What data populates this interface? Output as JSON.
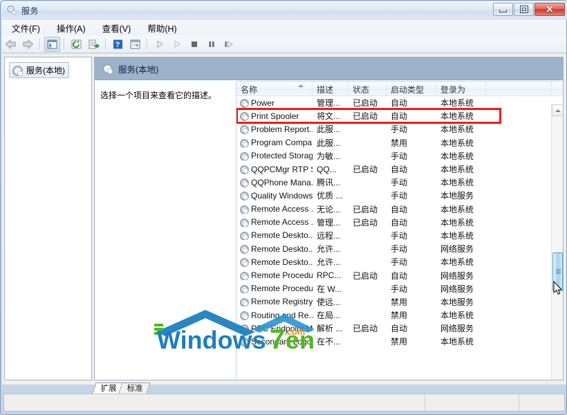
{
  "window": {
    "title": "服务",
    "title_icon": "services-gear-icon",
    "buttons": {
      "minimize": "最小化",
      "restore": "还原",
      "close": "关闭",
      "close_glyph": "✕"
    }
  },
  "menubar": {
    "items": [
      {
        "label": "文件(F)",
        "name": "menu-file"
      },
      {
        "label": "操作(A)",
        "name": "menu-action"
      },
      {
        "label": "查看(V)",
        "name": "menu-view"
      },
      {
        "label": "帮助(H)",
        "name": "menu-help"
      }
    ]
  },
  "toolbar": {
    "items": [
      {
        "name": "back-arrow-icon",
        "label": "后退",
        "enabled": true
      },
      {
        "name": "forward-arrow-icon",
        "label": "前进",
        "enabled": true
      },
      {
        "name": "separator-1",
        "label": "",
        "enabled": false
      },
      {
        "name": "show-hide-tree-icon",
        "label": "显示/隐藏控制台树",
        "enabled": true
      },
      {
        "name": "separator-2",
        "label": "",
        "enabled": false
      },
      {
        "name": "refresh-icon",
        "label": "刷新",
        "enabled": true
      },
      {
        "name": "export-list-icon",
        "label": "导出列表",
        "enabled": true
      },
      {
        "name": "separator-3",
        "label": "",
        "enabled": false
      },
      {
        "name": "help-icon",
        "label": "帮助",
        "enabled": true
      },
      {
        "name": "properties-icon",
        "label": "属性",
        "enabled": true
      },
      {
        "name": "separator-4",
        "label": "",
        "enabled": false
      },
      {
        "name": "start-service-icon",
        "label": "启动服务",
        "enabled": false
      },
      {
        "name": "start-all-icon",
        "label": "启动",
        "enabled": false
      },
      {
        "name": "stop-service-icon",
        "label": "停止服务",
        "enabled": false
      },
      {
        "name": "pause-service-icon",
        "label": "暂停服务",
        "enabled": false
      },
      {
        "name": "restart-service-icon",
        "label": "重启动服务",
        "enabled": false
      }
    ]
  },
  "tree": {
    "root": {
      "label": "服务(本地)",
      "icon": "services-gear-icon",
      "selected": true
    }
  },
  "pane": {
    "header": "服务(本地)",
    "header_icon": "services-gear-icon",
    "description": "选择一个项目来查看它的描述。"
  },
  "list": {
    "columns": [
      {
        "label": "名称",
        "width": 110,
        "sorted": "asc"
      },
      {
        "label": "描述",
        "width": 52,
        "sorted": ""
      },
      {
        "label": "状态",
        "width": 55,
        "sorted": ""
      },
      {
        "label": "启动类型",
        "width": 72,
        "sorted": ""
      },
      {
        "label": "登录为",
        "width": 72,
        "sorted": ""
      },
      {
        "label": "",
        "width": 95,
        "sorted": ""
      }
    ],
    "rows": [
      {
        "name": "Power",
        "desc": "管理...",
        "status": "已启动",
        "startup": "自动",
        "logon": "本地系统"
      },
      {
        "name": "Print Spooler",
        "desc": "将文...",
        "status": "已启动",
        "startup": "自动",
        "logon": "本地系统",
        "highlighted": true
      },
      {
        "name": "Problem Report...",
        "desc": "此服...",
        "status": "",
        "startup": "手动",
        "logon": "本地系统"
      },
      {
        "name": "Program Compa...",
        "desc": "此服...",
        "status": "",
        "startup": "禁用",
        "logon": "本地系统"
      },
      {
        "name": "Protected Storage",
        "desc": "为敏...",
        "status": "",
        "startup": "手动",
        "logon": "本地系统"
      },
      {
        "name": "QQPCMgr RTP S...",
        "desc": "QQ...",
        "status": "已启动",
        "startup": "自动",
        "logon": "本地系统"
      },
      {
        "name": "QQPhone Mana...",
        "desc": "腾讯...",
        "status": "",
        "startup": "手动",
        "logon": "本地系统"
      },
      {
        "name": "Quality Windows...",
        "desc": "优质 ...",
        "status": "",
        "startup": "手动",
        "logon": "本地服务"
      },
      {
        "name": "Remote Access ...",
        "desc": "无论...",
        "status": "已启动",
        "startup": "自动",
        "logon": "本地系统"
      },
      {
        "name": "Remote Access ...",
        "desc": "管理...",
        "status": "已启动",
        "startup": "自动",
        "logon": "本地系统"
      },
      {
        "name": "Remote Deskto...",
        "desc": "远程...",
        "status": "",
        "startup": "手动",
        "logon": "本地系统"
      },
      {
        "name": "Remote Deskto...",
        "desc": "允许...",
        "status": "",
        "startup": "手动",
        "logon": "网络服务"
      },
      {
        "name": "Remote Deskto...",
        "desc": "允许...",
        "status": "",
        "startup": "手动",
        "logon": "本地系统"
      },
      {
        "name": "Remote Procedu...",
        "desc": "RPC...",
        "status": "已启动",
        "startup": "自动",
        "logon": "网络服务"
      },
      {
        "name": "Remote Procedu...",
        "desc": "在 W...",
        "status": "",
        "startup": "手动",
        "logon": "网络服务"
      },
      {
        "name": "Remote Registry",
        "desc": "使远...",
        "status": "",
        "startup": "禁用",
        "logon": "本地服务"
      },
      {
        "name": "Routing and Re...",
        "desc": "在局...",
        "status": "",
        "startup": "禁用",
        "logon": "本地系统"
      },
      {
        "name": "RPC Endpoint M...",
        "desc": "解析 ...",
        "status": "已启动",
        "startup": "自动",
        "logon": "网络服务"
      },
      {
        "name": "Secondary Logon",
        "desc": "在不...",
        "status": "",
        "startup": "禁用",
        "logon": "本地系统"
      }
    ]
  },
  "annotation": {
    "color": "#ef1c13",
    "target_row": "Print Spooler"
  },
  "watermark": {
    "text_primary": "Windows",
    "text_seven": "7",
    "text_suffix": "en",
    "text_domain": ".com",
    "color_blue": "#1f7fc0",
    "color_green": "#4fb81f"
  },
  "tabs": [
    {
      "label": "扩展",
      "active": true
    },
    {
      "label": "标准",
      "active": false
    }
  ],
  "statusbar": {
    "text": ""
  }
}
